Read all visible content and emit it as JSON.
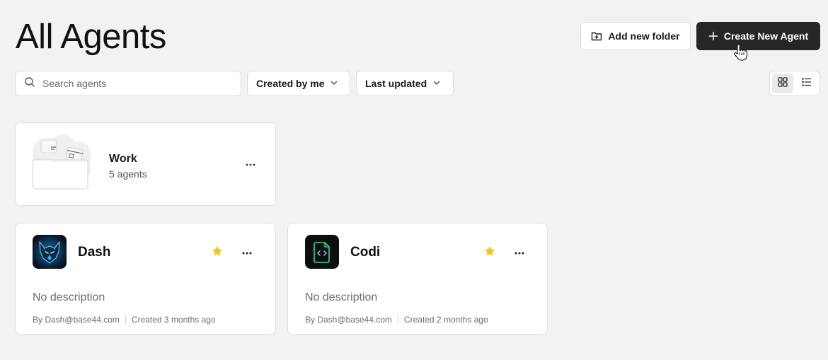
{
  "header": {
    "title": "All Agents",
    "add_folder_label": "Add new folder",
    "create_agent_label": "Create New Agent"
  },
  "toolbar": {
    "search_placeholder": "Search agents",
    "filter_owner": "Created by me",
    "sort": "Last updated",
    "view_mode": "grid"
  },
  "folders": [
    {
      "name": "Work",
      "count_label": "5 agents"
    }
  ],
  "agents": [
    {
      "name": "Dash",
      "description": "No description",
      "author": "By Dash@base44.com",
      "created": "Created 3 months ago",
      "starred": true,
      "icon": "wolf-icon"
    },
    {
      "name": "Codi",
      "description": "No description",
      "author": "By Dash@base44.com",
      "created": "Created 2 months ago",
      "starred": true,
      "icon": "code-file-icon"
    }
  ],
  "colors": {
    "background": "#f3f2f0",
    "primary_button": "#262626",
    "star": "#f5c518",
    "codi_accent": "#3ecfa0",
    "dash_accent": "#3aa8e8"
  }
}
